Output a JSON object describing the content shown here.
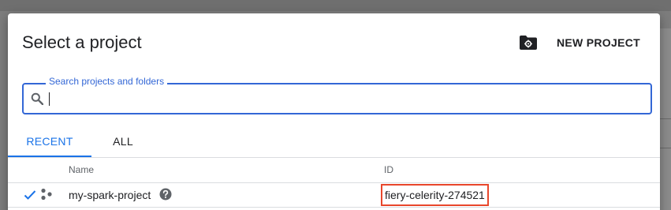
{
  "dialog": {
    "title": "Select a project",
    "new_project_label": "NEW PROJECT",
    "new_project_icon": "folder-settings-icon"
  },
  "search": {
    "label": "Search projects and folders",
    "value": "",
    "placeholder": "",
    "icon": "search-icon"
  },
  "tabs": [
    {
      "label": "RECENT",
      "active": true
    },
    {
      "label": "ALL",
      "active": false
    }
  ],
  "table": {
    "columns": [
      "Name",
      "ID"
    ],
    "rows": [
      {
        "selected": true,
        "name": "my-spark-project",
        "id": "fiery-celerity-274521",
        "icons": [
          "check-icon",
          "project-nodes-icon",
          "help-icon"
        ]
      }
    ]
  },
  "colors": {
    "accent": "#1a73e8",
    "search_border": "#3367d6",
    "highlight_box": "#e8472b",
    "overlay": "#7d7d7d"
  }
}
